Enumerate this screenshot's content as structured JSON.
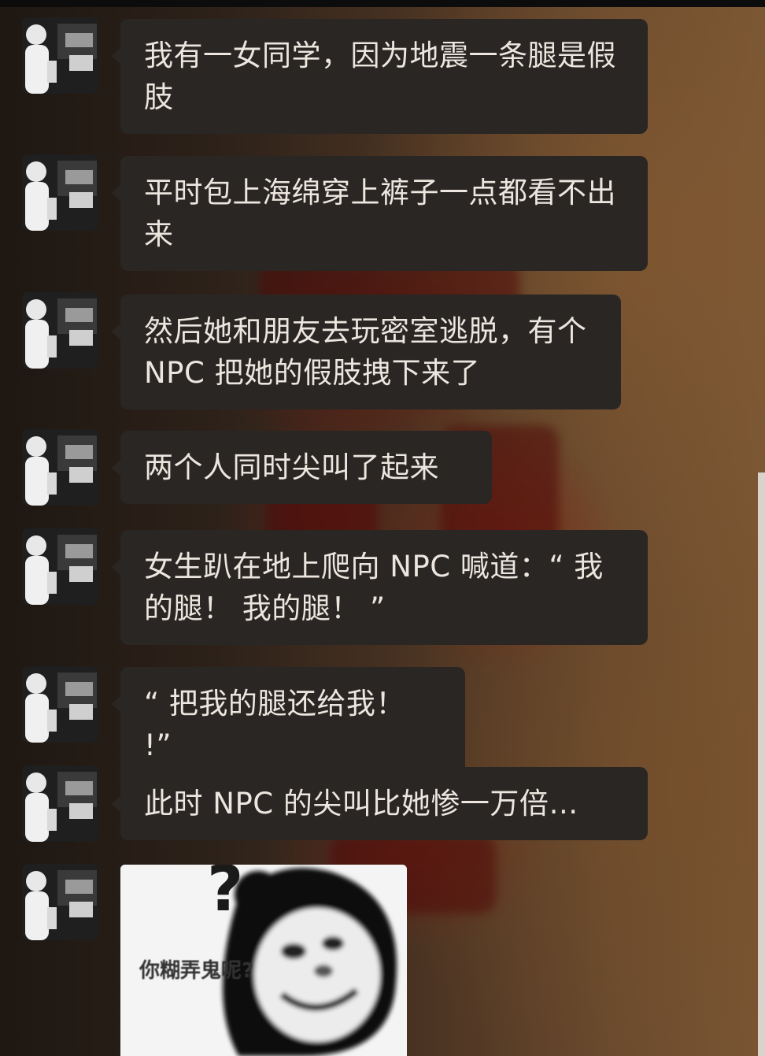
{
  "chat": {
    "messages": [
      {
        "text": "我有一女同学，因为地震一条腿是假肢"
      },
      {
        "text": "平时包上海绵穿上裤子一点都看不出来"
      },
      {
        "text": "然后她和朋友去玩密室逃脱，有个 NPC 把她的假肢拽下来了"
      },
      {
        "text": "两个人同时尖叫了起来"
      },
      {
        "text": "女生趴在地上爬向 NPC 喊道：“ 我的腿！ 我的腿！ ”"
      },
      {
        "text": "“ 把我的腿还给我！ !”"
      },
      {
        "text": "此时 NPC 的尖叫比她惨一万倍…"
      }
    ],
    "meme": {
      "caption": "你糊弄鬼呢?",
      "question_mark": "?"
    }
  },
  "colors": {
    "bubble": "#2a2623",
    "bubble_text": "#ece6df",
    "background": "#2b1e15"
  }
}
